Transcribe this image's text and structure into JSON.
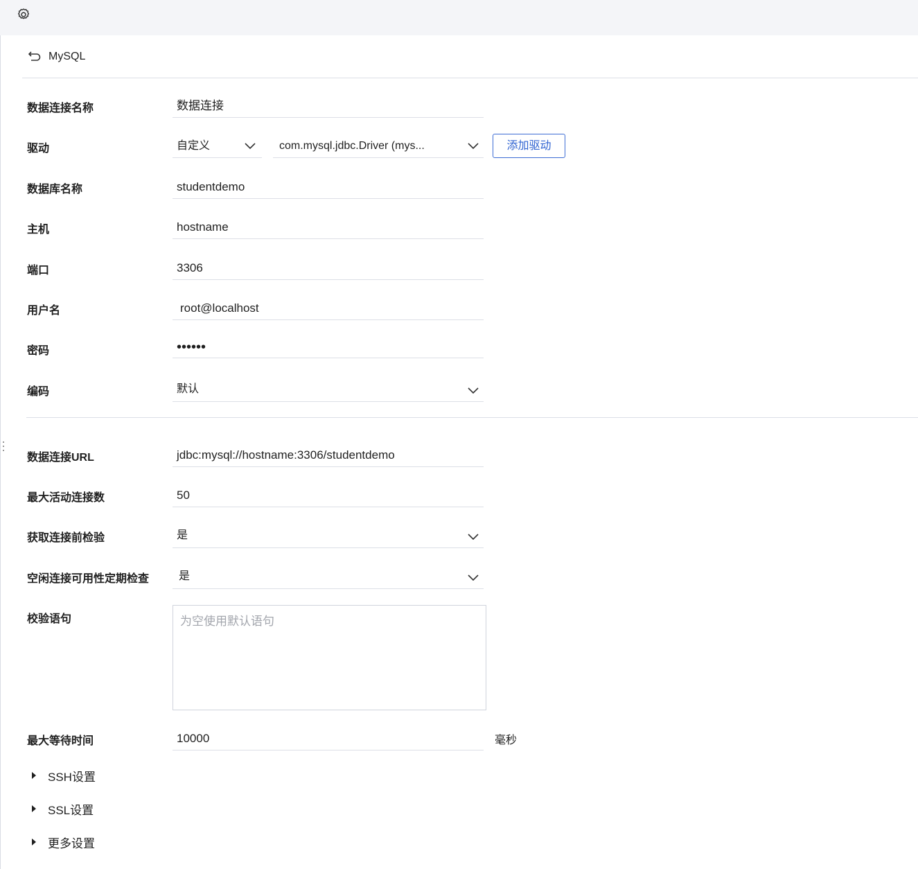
{
  "header": {
    "settings_icon": "gear-icon"
  },
  "back": {
    "icon": "undo-arrow-icon",
    "title": "MySQL"
  },
  "form": {
    "connection_name": {
      "label": "数据连接名称",
      "value": "数据连接"
    },
    "driver": {
      "label": "驱动",
      "type_value": "自定义",
      "driver_value": "com.mysql.jdbc.Driver (mys...",
      "add_button": "添加驱动"
    },
    "database_name": {
      "label": "数据库名称",
      "value": "studentdemo"
    },
    "host": {
      "label": "主机",
      "value": "hostname"
    },
    "port": {
      "label": "端口",
      "value": "3306"
    },
    "username": {
      "label": "用户名",
      "value": "root@localhost"
    },
    "password": {
      "label": "密码",
      "value": "••••••"
    },
    "encoding": {
      "label": "编码",
      "value": "默认"
    },
    "url": {
      "label": "数据连接URL",
      "value": "jdbc:mysql://hostname:3306/studentdemo"
    },
    "max_active": {
      "label": "最大活动连接数",
      "value": "50"
    },
    "test_on_borrow": {
      "label": "获取连接前检验",
      "value": "是"
    },
    "test_while_idle": {
      "label": "空闲连接可用性定期检查",
      "value": "是"
    },
    "validation_query": {
      "label": "校验语句",
      "placeholder": "为空使用默认语句"
    },
    "max_wait": {
      "label": "最大等待时间",
      "value": "10000",
      "unit": "毫秒"
    }
  },
  "sections": [
    {
      "label": "SSH设置"
    },
    {
      "label": "SSL设置"
    },
    {
      "label": "更多设置"
    }
  ],
  "colors": {
    "accent": "#2f63d1",
    "divider": "#dcdfe6",
    "topbar": "#f4f5f8"
  }
}
